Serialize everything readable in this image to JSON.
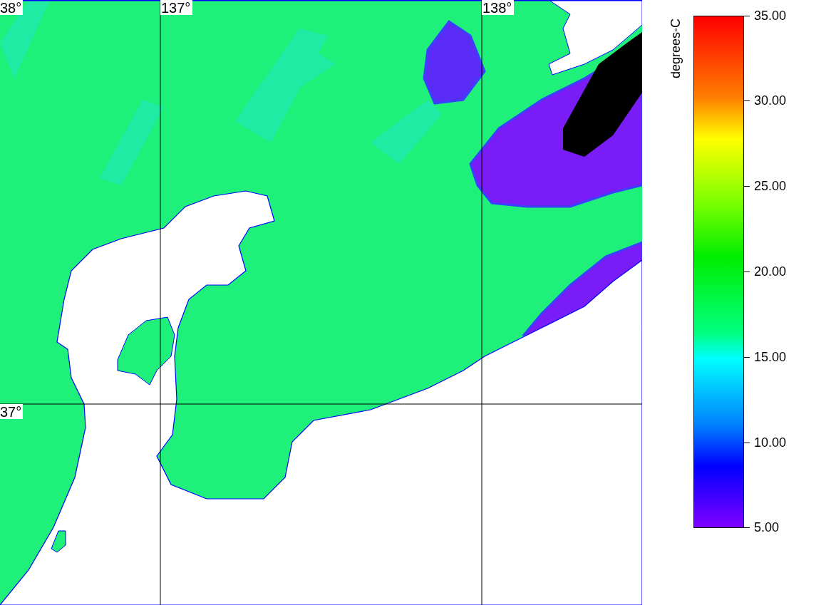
{
  "map": {
    "longitude_labels": [
      "137°",
      "138°"
    ],
    "latitude_labels": [
      "38°",
      "37°"
    ]
  },
  "colorbar": {
    "title": "degrees-C",
    "ticks": [
      "35.00",
      "30.00",
      "25.00",
      "20.00",
      "15.00",
      "10.00",
      "5.00"
    ]
  }
}
